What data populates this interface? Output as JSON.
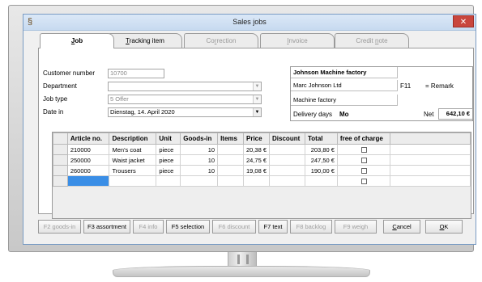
{
  "window": {
    "title": "Sales jobs",
    "close": "✕",
    "app_icon": "§"
  },
  "tabs": [
    {
      "prefix": "",
      "underline": "J",
      "rest": "ob"
    },
    {
      "prefix": "",
      "underline": "T",
      "rest": "racking item"
    },
    {
      "prefix": "Co",
      "underline": "r",
      "rest": "rection"
    },
    {
      "prefix": "",
      "underline": "I",
      "rest": "nvoice"
    },
    {
      "prefix": "Credit ",
      "underline": "n",
      "rest": "ote"
    }
  ],
  "form": {
    "customer_number_label": "Customer number",
    "customer_number": "10700",
    "department_label": "Department",
    "job_type_label": "Job type",
    "job_type": "5  Offer",
    "date_in_label": "Date in",
    "date_in": "Dienstag, 14. April 2020"
  },
  "address": {
    "company": "Johnson Machine factory",
    "contact": "Marc Johnson Ltd",
    "line3": "Machine factory",
    "delivery_days_label": "Delivery days",
    "delivery_days": "Mo",
    "f11": "F11",
    "remark": "= Remark",
    "net_label": "Net",
    "net_value": "642,10 €"
  },
  "grid": {
    "columns": [
      "Article no.",
      "Description",
      "Unit",
      "Goods-in",
      "Items",
      "Price",
      "Discount",
      "Total",
      "free of charge"
    ],
    "rows": [
      [
        "210000",
        "Men's coat",
        "piece",
        "10",
        "",
        "20,38 €",
        "",
        "203,80 €",
        ""
      ],
      [
        "250000",
        "Waist jacket",
        "piece",
        "10",
        "",
        "24,75 €",
        "",
        "247,50 €",
        ""
      ],
      [
        "260000",
        "Trousers",
        "piece",
        "10",
        "",
        "19,08 €",
        "",
        "190,00 €",
        ""
      ]
    ]
  },
  "buttons": [
    {
      "label": "F2 goods-in",
      "enabled": false
    },
    {
      "label": "F3 assortment",
      "enabled": true
    },
    {
      "label": "F4 info",
      "enabled": false
    },
    {
      "label": "F5 selection",
      "enabled": true
    },
    {
      "label": "F6 discount",
      "enabled": false
    },
    {
      "label": "F7 text",
      "enabled": true
    },
    {
      "label": "F8 backlog",
      "enabled": false
    },
    {
      "label": "F9 weigh",
      "enabled": false
    },
    {
      "underline": "C",
      "rest": "ancel",
      "enabled": true
    },
    {
      "underline": "O",
      "rest": "K",
      "enabled": true
    }
  ]
}
